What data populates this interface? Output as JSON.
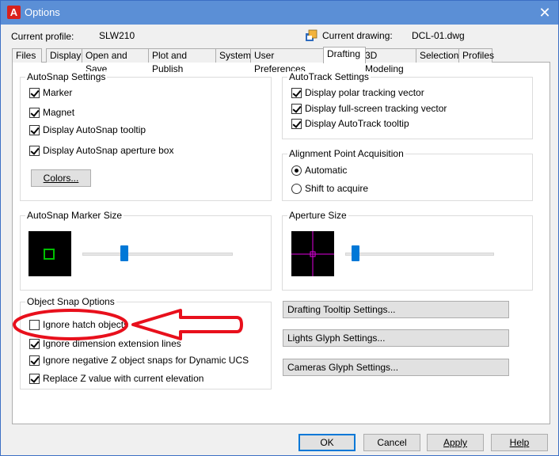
{
  "window": {
    "title": "Options",
    "app_icon": "A",
    "close_glyph": "✕"
  },
  "profile": {
    "label": "Current profile:",
    "value": "SLW210"
  },
  "drawing": {
    "label": "Current drawing:",
    "value": "DCL-01.dwg"
  },
  "tabs": [
    {
      "label": "Files"
    },
    {
      "label": "Display"
    },
    {
      "label": "Open and Save"
    },
    {
      "label": "Plot and Publish"
    },
    {
      "label": "System"
    },
    {
      "label": "User Preferences"
    },
    {
      "label": "Drafting"
    },
    {
      "label": "3D Modeling"
    },
    {
      "label": "Selection"
    },
    {
      "label": "Profiles"
    }
  ],
  "active_tab": "Drafting",
  "autosnap": {
    "title": "AutoSnap Settings",
    "marker": "Marker",
    "magnet": "Magnet",
    "tooltip": "Display AutoSnap tooltip",
    "aperture": "Display AutoSnap aperture box",
    "colors_button": "Colors..."
  },
  "autotrack": {
    "title": "AutoTrack Settings",
    "polar": "Display polar tracking vector",
    "fullscreen": "Display full-screen tracking vector",
    "tooltip": "Display AutoTrack tooltip"
  },
  "alignment": {
    "title": "Alignment Point Acquisition",
    "automatic": "Automatic",
    "shift": "Shift to acquire"
  },
  "marker_size": {
    "title": "AutoSnap Marker Size",
    "level": 0.28
  },
  "aperture_size": {
    "title": "Aperture Size",
    "level": 0.07
  },
  "osnap": {
    "title": "Object Snap Options",
    "hatch": "Ignore hatch objects",
    "dimension": "Ignore dimension extension lines",
    "negative_z": "Ignore negative Z object snaps for Dynamic UCS",
    "replace_z": "Replace Z value with current elevation"
  },
  "side_buttons": {
    "tooltip": "Drafting Tooltip Settings...",
    "lights": "Lights Glyph Settings...",
    "cameras": "Cameras Glyph Settings..."
  },
  "footer": {
    "ok": "OK",
    "cancel": "Cancel",
    "apply": "Apply",
    "help": "Help"
  },
  "colors": {
    "annotation_red": "#e8101c",
    "accent_blue": "#0078d7",
    "marker_green": "#00c000",
    "crosshair_magenta": "#e000e0"
  }
}
